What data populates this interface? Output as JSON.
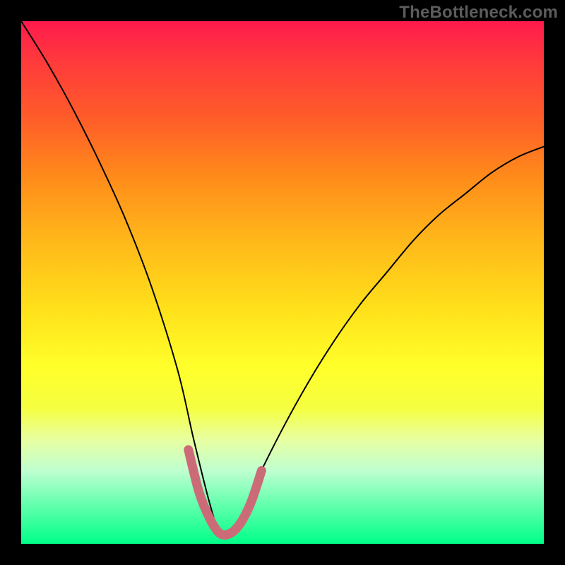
{
  "watermark": "TheBottleneck.com",
  "colors": {
    "background": "#000000",
    "curve": "#000000",
    "highlight": "#cc6b78",
    "gradient_top": "#ff1a4d",
    "gradient_bottom": "#00ff88"
  },
  "chart_data": {
    "type": "line",
    "title": "",
    "xlabel": "",
    "ylabel": "",
    "xlim": [
      0,
      100
    ],
    "ylim": [
      0,
      100
    ],
    "axes_visible": false,
    "grid": false,
    "description": "Bottleneck curve: vertical position encodes mismatch (top=red=high bottleneck, bottom=green=balanced). Minimum near x≈38.",
    "series": [
      {
        "name": "bottleneck-curve",
        "x": [
          0,
          5,
          10,
          15,
          20,
          25,
          30,
          33,
          36,
          38,
          40,
          42,
          45,
          50,
          55,
          60,
          65,
          70,
          75,
          80,
          85,
          90,
          95,
          100
        ],
        "y": [
          100,
          92,
          83,
          73,
          62,
          49,
          33,
          20,
          8,
          2,
          2,
          5,
          12,
          22,
          31,
          39,
          46,
          52,
          58,
          63,
          67,
          71,
          74,
          76
        ]
      },
      {
        "name": "optimal-region-highlight",
        "x": [
          32,
          34,
          36,
          38,
          40,
          42,
          44,
          46
        ],
        "y": [
          18,
          10,
          5,
          2,
          2,
          4,
          8,
          14
        ]
      }
    ]
  }
}
